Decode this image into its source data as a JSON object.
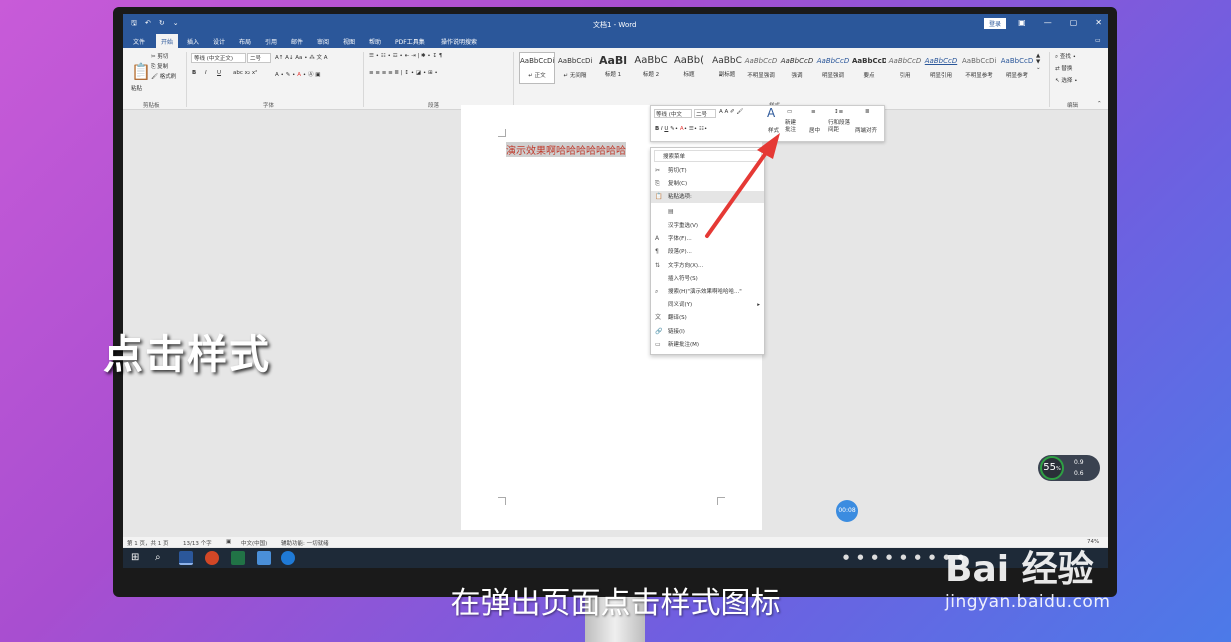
{
  "word": {
    "title": "文档1 - Word",
    "login": "登录",
    "tabs": [
      "文件",
      "开始",
      "插入",
      "设计",
      "布局",
      "引用",
      "邮件",
      "审阅",
      "视图",
      "帮助",
      "PDF工具集",
      "操作说明搜索"
    ],
    "active_tab": "开始",
    "ribbon": {
      "clipboard": {
        "paste": "粘贴",
        "cut": "剪切",
        "copy": "复制",
        "format_painter": "格式刷",
        "label": "剪贴板"
      },
      "font": {
        "name": "等线 (中文正文)",
        "size": "二号",
        "label": "字体"
      },
      "paragraph": {
        "label": "段落"
      },
      "styles": {
        "label": "样式",
        "items": [
          {
            "sample": "AaBbCcDi",
            "name": "↵ 正文"
          },
          {
            "sample": "AaBbCcDi",
            "name": "↵ 无间隔"
          },
          {
            "sample": "AaBl",
            "name": "标题 1"
          },
          {
            "sample": "AaBbC",
            "name": "标题 2"
          },
          {
            "sample": "AaBb(",
            "name": "标题"
          },
          {
            "sample": "AaBbC",
            "name": "副标题"
          },
          {
            "sample": "AaBbCcD",
            "name": "不明显强调"
          },
          {
            "sample": "AaBbCcD",
            "name": "强调"
          },
          {
            "sample": "AaBbCcD",
            "name": "明显强调"
          },
          {
            "sample": "AaBbCcD",
            "name": "要点"
          },
          {
            "sample": "AaBbCcD",
            "name": "引用"
          },
          {
            "sample": "AaBbCcD",
            "name": "明显引用"
          },
          {
            "sample": "AaBbCcDi",
            "name": "不明显参考"
          },
          {
            "sample": "AaBbCcD",
            "name": "明显参考"
          }
        ]
      },
      "editing": {
        "find": "查找",
        "replace": "替换",
        "select": "选择",
        "label": "编辑"
      }
    },
    "document_text": "演示效果啊哈哈哈哈哈哈哈",
    "mini_toolbar": {
      "font": "等线 (中文",
      "size": "二号",
      "styles_label": "样式",
      "new_comment": "新建批注",
      "center": "居中",
      "line_spacing": "行和段落间距",
      "justify": "两端对齐"
    },
    "context_menu": [
      {
        "label": "搜索菜单",
        "icon": ""
      },
      {
        "label": "剪切(T)",
        "icon": "✂"
      },
      {
        "label": "复制(C)",
        "icon": "⎘"
      },
      {
        "label": "粘贴选项:",
        "icon": "📋"
      },
      {
        "label": "",
        "icon": "▤"
      },
      {
        "label": "汉字重选(V)",
        "icon": ""
      },
      {
        "label": "字体(F)...",
        "icon": "A"
      },
      {
        "label": "段落(P)...",
        "icon": "¶"
      },
      {
        "label": "文字方向(X)...",
        "icon": "⇅"
      },
      {
        "label": "插入符号(S)",
        "icon": ""
      },
      {
        "label": "搜索(H)\"演示效果啊哈哈哈...\"",
        "icon": "⌕"
      },
      {
        "label": "同义词(Y)",
        "icon": ""
      },
      {
        "label": "翻译(S)",
        "icon": "文"
      },
      {
        "label": "链接(I)",
        "icon": "🔗"
      },
      {
        "label": "新建批注(M)",
        "icon": "▭"
      }
    ],
    "status": {
      "page": "第 1 页，共 1 页",
      "words": "13/13 个字",
      "lang": "中文(中国)",
      "accessibility": "辅助功能: 一切就绪",
      "zoom": "74%"
    }
  },
  "overlay": {
    "caption_left": "点击样式",
    "caption_bottom": "在弹出页面点击样式图标",
    "timer": "00:08",
    "gauge": {
      "pct": "55",
      "unit": "%",
      "up": "0.9",
      "down": "0.6"
    },
    "watermark": {
      "brand": "Bai 经验",
      "url": "jingyan.baidu.com"
    }
  },
  "colors": {
    "word_blue": "#2b579a",
    "arrow_red": "#e53935",
    "selection_text": "#c0392b"
  }
}
